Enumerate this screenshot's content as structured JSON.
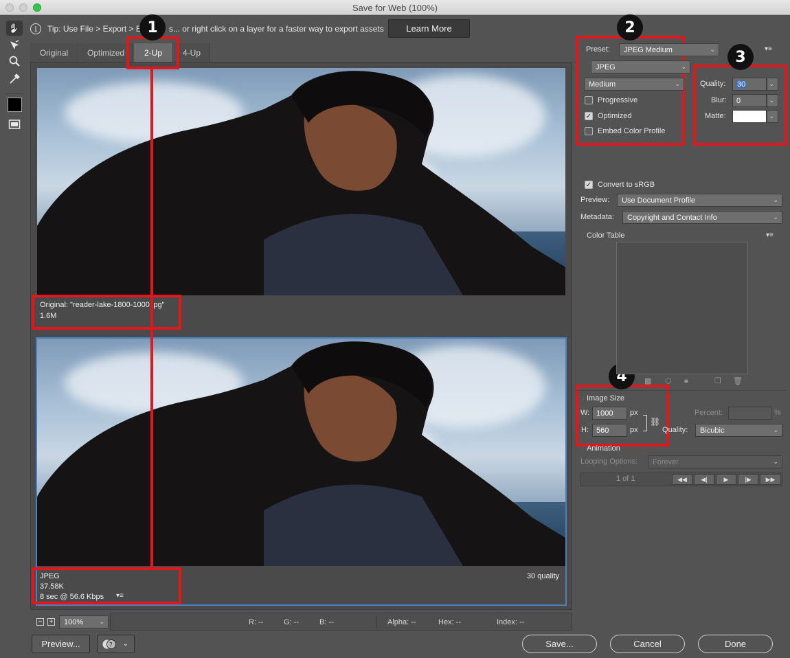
{
  "window": {
    "title": "Save for Web (100%)"
  },
  "tools": [
    "hand-tool",
    "slice-select-tool",
    "zoom-tool",
    "eyedropper-tool",
    "eyedropper-color-swatch",
    "toggle-slices-visibility"
  ],
  "tip": {
    "text": "Tip: Use File > Export > E",
    "text_after": "s... or right click on a layer for a faster way to export assets",
    "learn_more": "Learn More"
  },
  "tabs": [
    {
      "label": "Original"
    },
    {
      "label": "Optimized"
    },
    {
      "label": "2-Up"
    },
    {
      "label": "4-Up"
    }
  ],
  "original_pane": {
    "filename": "Original: \"reader-lake-1800-1000.jpg\"",
    "size": "1.6M"
  },
  "optimized_pane": {
    "format": "JPEG",
    "size": "37.58K",
    "time": "8 sec @ 56.6 Kbps",
    "quality": "30 quality"
  },
  "annotations": [
    "1",
    "2",
    "3",
    "4"
  ],
  "zoom": {
    "value": "100%"
  },
  "status": {
    "r": "R: --",
    "g": "G: --",
    "b": "B: --",
    "alpha": "Alpha: --",
    "hex": "Hex: --",
    "index": "Index: --"
  },
  "buttons": {
    "preview": "Preview...",
    "save": "Save...",
    "cancel": "Cancel",
    "done": "Done"
  },
  "settings": {
    "preset_label": "Preset:",
    "preset_value": "JPEG Medium",
    "format": "JPEG",
    "quality_level": "Medium",
    "progressive": {
      "label": "Progressive",
      "checked": false
    },
    "optimized": {
      "label": "Optimized",
      "checked": true
    },
    "embed_profile": {
      "label": "Embed Color Profile",
      "checked": false
    },
    "quality_label": "Quality:",
    "quality_value": "30",
    "blur_label": "Blur:",
    "blur_value": "0",
    "matte_label": "Matte:",
    "convert_srgb": {
      "label": "Convert to sRGB",
      "checked": true
    },
    "preview_label": "Preview:",
    "preview_value": "Use Document Profile",
    "metadata_label": "Metadata:",
    "metadata_value": "Copyright and Contact Info",
    "color_table_label": "Color Table"
  },
  "image_size": {
    "title": "Image Size",
    "w_label": "W:",
    "w_value": "1000",
    "h_label": "H:",
    "h_value": "560",
    "unit": "px",
    "percent_label": "Percent:",
    "percent_unit": "%",
    "quality_label": "Quality:",
    "quality_value": "Bicubic"
  },
  "animation": {
    "title": "Animation",
    "looping_label": "Looping Options:",
    "looping_value": "Forever",
    "frame": "1 of 1"
  },
  "colors": {
    "annotation_red": "#e3161b",
    "panel_bg": "#535353",
    "selection_blue": "#4a7fc1"
  }
}
